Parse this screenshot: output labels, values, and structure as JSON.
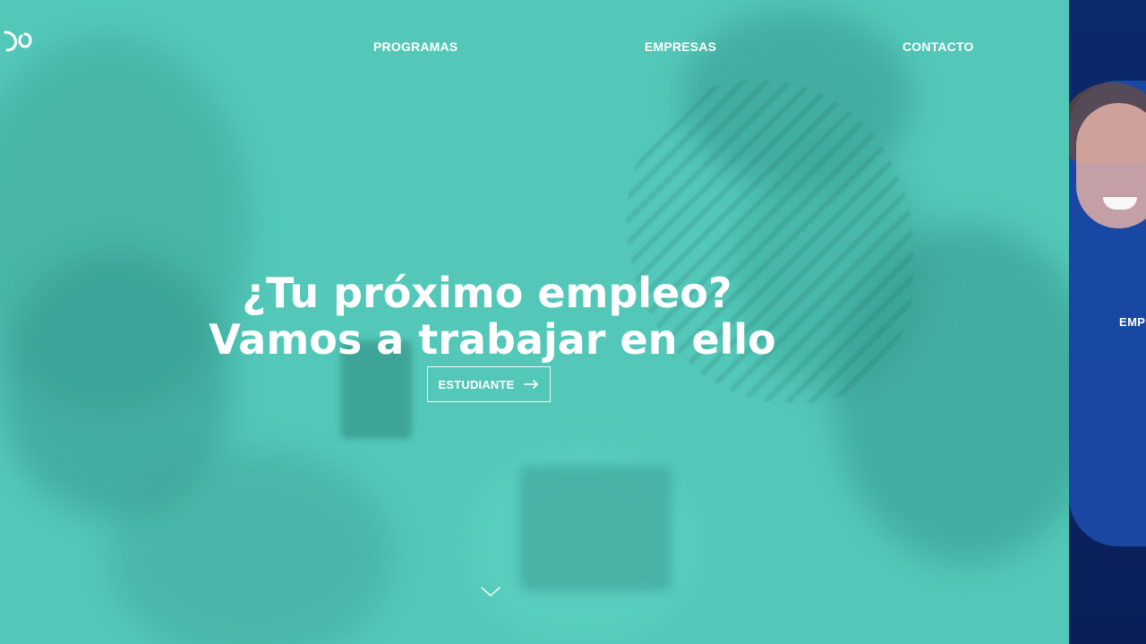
{
  "nav": {
    "items": [
      {
        "label": "PROGRAMAS"
      },
      {
        "label": "EMPRESAS"
      },
      {
        "label": "CONTACTO"
      }
    ]
  },
  "hero": {
    "title_line_1": "¿Tu próximo empleo?",
    "title_line_2": "Vamos a trabajar en ello",
    "cta_label": "ESTUDIANTE",
    "cta_icon": "arrow-right-icon",
    "scroll_icon": "chevron-down-icon"
  },
  "side_panel": {
    "label": "EMPR"
  },
  "colors": {
    "teal_overlay": "#53c8b9",
    "side_blue": "#0b2a6b",
    "text_white": "#ffffff"
  }
}
